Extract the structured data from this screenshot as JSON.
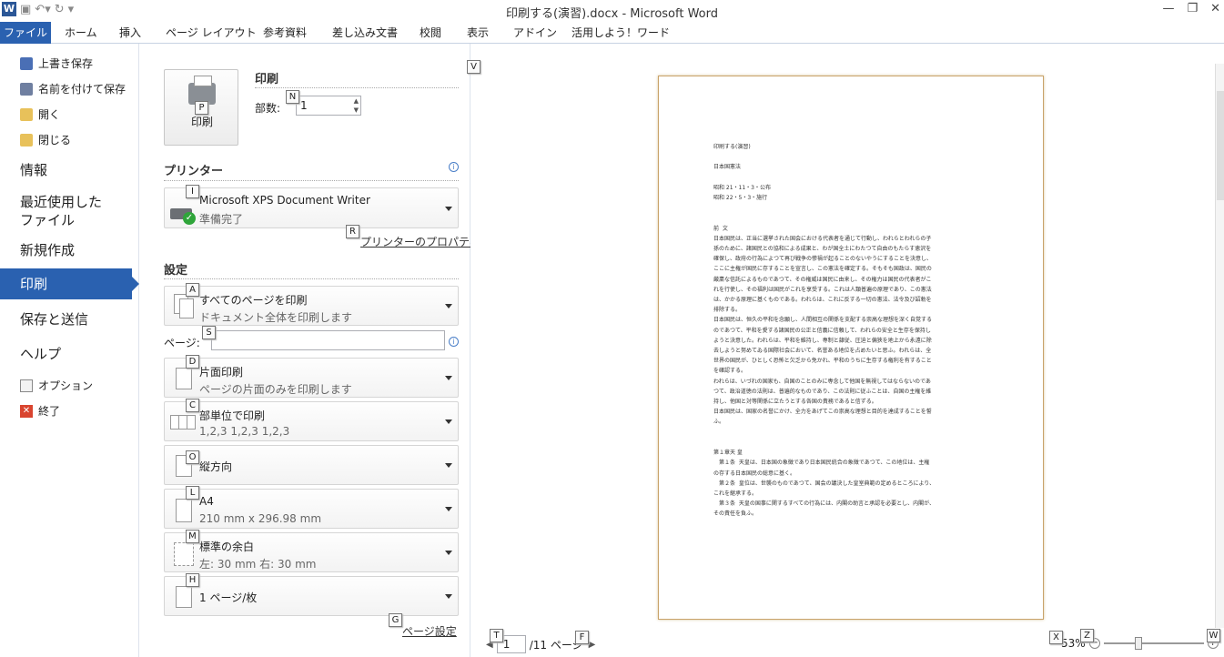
{
  "window": {
    "title": "印刷する(演習).docx - Microsoft Word",
    "app_icon": "W"
  },
  "ribbon_tabs": [
    "ファイル",
    "ホーム",
    "挿入",
    "ページ レイアウト",
    "参考資料",
    "差し込み文書",
    "校閲",
    "表示",
    "アドイン",
    "活用しよう！ワード"
  ],
  "backstage": {
    "items_small_top": [
      {
        "label": "上書き保存",
        "icon": "save-icon"
      },
      {
        "label": "名前を付けて保存",
        "icon": "save-as-icon"
      },
      {
        "label": "開く",
        "icon": "open-folder-icon"
      },
      {
        "label": "閉じる",
        "icon": "close-folder-icon"
      }
    ],
    "info": "情報",
    "recent_line1": "最近使用した",
    "recent_line2": "ファイル",
    "new": "新規作成",
    "print": "印刷",
    "save_send": "保存と送信",
    "help": "ヘルプ",
    "options": "オプション",
    "exit": "終了"
  },
  "print_panel": {
    "print_button_label": "印刷",
    "header": "印刷",
    "copies_label": "部数:",
    "copies_value": "1",
    "printer_header": "プリンター",
    "printer_name": "Microsoft XPS Document Writer",
    "printer_status": "準備完了",
    "printer_properties": "プリンターのプロパティ",
    "settings_header": "設定",
    "pages_label": "ページ:",
    "page_setup_link": "ページ設定",
    "settings": [
      {
        "l1": "すべてのページを印刷",
        "l2": "ドキュメント全体を印刷します"
      },
      {
        "l1": "片面印刷",
        "l2": "ページの片面のみを印刷します"
      },
      {
        "l1": "部単位で印刷",
        "l2": "1,2,3    1,2,3    1,2,3"
      },
      {
        "l1": "縦方向",
        "l2": ""
      },
      {
        "l1": "A4",
        "l2": "210 mm x 296.98 mm"
      },
      {
        "l1": "標準の余白",
        "l2": "左:  30 mm     右:  30 mm"
      },
      {
        "l1": "1 ページ/枚",
        "l2": ""
      }
    ]
  },
  "keytips": {
    "v": "V",
    "n": "N",
    "p": "P",
    "i": "I",
    "r": "R",
    "a": "A",
    "s": "S",
    "d": "D",
    "c": "C",
    "o": "O",
    "l": "L",
    "m": "M",
    "h": "H",
    "g": "G",
    "t": "T",
    "f": "F",
    "x": "X",
    "z": "Z",
    "w": "W"
  },
  "preview": {
    "doc_lines": [
      "印刷する(演習)",
      "",
      "日本国憲法",
      "",
      "昭和 21・11・3・公布",
      "昭和 22・5・3・施行",
      "",
      "",
      "前  文",
      "日本国民は、正当に選挙された国会における代表者を通じて行動し、われらとわれらの子",
      "孫のために、諸国民との協和による成果と、わが国全土にわたつて自由のもたらす恵沢を",
      "確保し、政府の行為によつて再び戦争の惨禍が起ることのないやうにすることを決意し、",
      "ここに主権が国民に存することを宣言し、この憲法を確定する。そもそも国政は、国民の",
      "厳粛な信託によるものであつて、その権威は国民に由来し、その権力は国民の代表者がこ",
      "れを行使し、その福利は国民がこれを享受する。これは人類普遍の原理であり、この憲法",
      "は、かかる原理に基くものである。われらは、これに反する一切の憲法、法令及び詔勅を",
      "排除する。",
      "日本国民は、恒久の平和を念願し、人間相互の関係を支配する崇高な理想を深く自覚する",
      "のであつて、平和を愛する諸国民の公正と信義に信頼して、われらの安全と生存を保持し",
      "ようと決意した。われらは、平和を維持し、専制と隷従、圧迫と偏狭を地上から永遠に除",
      "去しようと努めてゐる国際社会において、名誉ある地位を占めたいと思ふ。われらは、全",
      "世界の国民が、ひとしく恐怖と欠乏から免かれ、平和のうちに生存する権利を有すること",
      "を確認する。",
      "われらは、いづれの国家も、自国のことのみに専念して他国を無視してはならないのであ",
      "つて、政治道徳の法則は、普遍的なものであり、この法則に従ふことは、自国の主権を維",
      "持し、他国と対等関係に立たうとする各国の責務であると信ずる。",
      "日本国民は、国家の名誉にかけ、全力をあげてこの崇高な理想と目的を達成することを誓",
      "ふ。",
      "",
      "",
      "第１章天 皇",
      "　第１条  天皇は、日本国の象徴であり日本国民統合の象徴であつて、この地位は、主権",
      "の存する日本国民の総意に基く。",
      "　第２条  皇位は、世襲のものであつて、国会の議決した皇室典範の定めるところにより、",
      "これを継承する。",
      "　第３条  天皇の国事に関するすべての行為には、内閣の助言と承認を必要とし、内閣が、",
      "その責任を負ふ。"
    ],
    "current_page": "1",
    "total_pages": "/11 ページ",
    "zoom": "53%"
  }
}
